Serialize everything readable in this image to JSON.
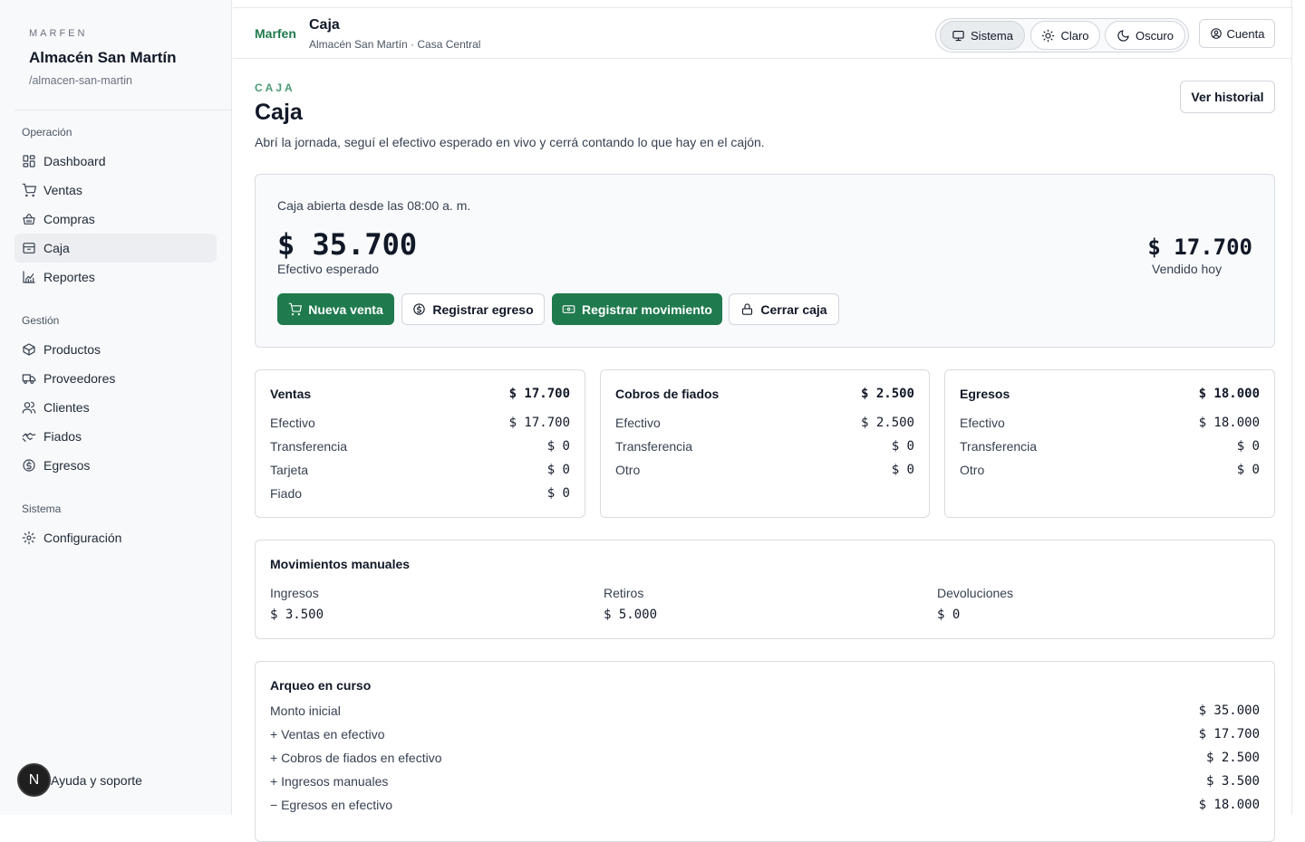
{
  "sidebar": {
    "eyebrow": "MARFEN",
    "store_name": "Almacén San Martín",
    "store_slug": "/almacen-san-martin",
    "sections": {
      "operacion": "Operación",
      "gestion": "Gestión",
      "sistema": "Sistema"
    },
    "items": {
      "dashboard": "Dashboard",
      "ventas": "Ventas",
      "compras": "Compras",
      "caja": "Caja",
      "reportes": "Reportes",
      "productos": "Productos",
      "proveedores": "Proveedores",
      "clientes": "Clientes",
      "fiados": "Fiados",
      "egresos": "Egresos",
      "configuracion": "Configuración"
    },
    "help_avatar": "N",
    "help_label": "Ayuda y soporte"
  },
  "header": {
    "brand": "Marfen",
    "title": "Caja",
    "subtitle": "Almacén San Martín · Casa Central",
    "theme": {
      "sistema": "Sistema",
      "claro": "Claro",
      "oscuro": "Oscuro"
    },
    "account": "Cuenta"
  },
  "page": {
    "eyebrow": "CAJA",
    "title": "Caja",
    "description": "Abrí la jornada, seguí el efectivo esperado en vivo y cerrá contando lo que hay en el cajón.",
    "history_button": "Ver historial"
  },
  "hero": {
    "status": "Caja abierta desde las 08:00 a. m.",
    "expected_amount": "$ 35.700",
    "expected_label": "Efectivo esperado",
    "sold_amount": "$ 17.700",
    "sold_label": "Vendido hoy",
    "buttons": {
      "nueva_venta": "Nueva venta",
      "registrar_egreso": "Registrar egreso",
      "registrar_movimiento": "Registrar movimiento",
      "cerrar_caja": "Cerrar caja"
    }
  },
  "stats": {
    "ventas": {
      "title": "Ventas",
      "total": "$ 17.700",
      "rows": [
        {
          "label": "Efectivo",
          "value": "$ 17.700"
        },
        {
          "label": "Transferencia",
          "value": "$ 0"
        },
        {
          "label": "Tarjeta",
          "value": "$ 0"
        },
        {
          "label": "Fiado",
          "value": "$ 0"
        }
      ]
    },
    "cobros": {
      "title": "Cobros de fiados",
      "total": "$ 2.500",
      "rows": [
        {
          "label": "Efectivo",
          "value": "$ 2.500"
        },
        {
          "label": "Transferencia",
          "value": "$ 0"
        },
        {
          "label": "Otro",
          "value": "$ 0"
        }
      ]
    },
    "egresos": {
      "title": "Egresos",
      "total": "$ 18.000",
      "rows": [
        {
          "label": "Efectivo",
          "value": "$ 18.000"
        },
        {
          "label": "Transferencia",
          "value": "$ 0"
        },
        {
          "label": "Otro",
          "value": "$ 0"
        }
      ]
    }
  },
  "manual": {
    "title": "Movimientos manuales",
    "ingresos_label": "Ingresos",
    "ingresos_value": "$ 3.500",
    "retiros_label": "Retiros",
    "retiros_value": "$ 5.000",
    "devoluciones_label": "Devoluciones",
    "devoluciones_value": "$ 0"
  },
  "arqueo": {
    "title": "Arqueo en curso",
    "rows": [
      {
        "label": "Monto inicial",
        "value": "$ 35.000"
      },
      {
        "label": "+ Ventas en efectivo",
        "value": "$ 17.700"
      },
      {
        "label": "+ Cobros de fiados en efectivo",
        "value": "$ 2.500"
      },
      {
        "label": "+ Ingresos manuales",
        "value": "$ 3.500"
      },
      {
        "label": "− Egresos en efectivo",
        "value": "$ 18.000"
      }
    ]
  },
  "colors": {
    "accent": "#1f7a4d",
    "eyebrow": "#4a9a75"
  }
}
